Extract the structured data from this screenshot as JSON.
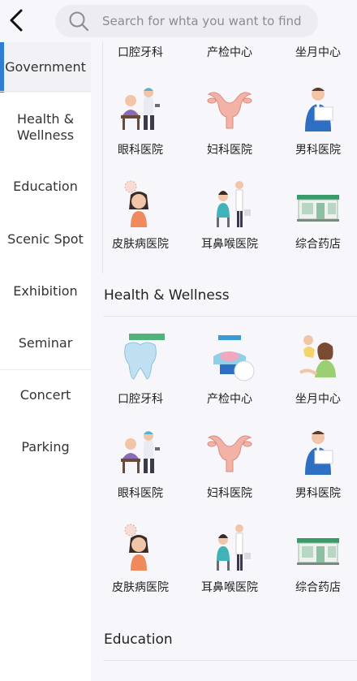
{
  "search": {
    "placeholder": "Search for whta you want to find"
  },
  "sidebar": {
    "items": [
      {
        "label": "Government",
        "active": true
      },
      {
        "label": "Health & Wellness",
        "active": false
      },
      {
        "label": "Education",
        "active": false
      },
      {
        "label": "Scenic Spot",
        "active": false
      },
      {
        "label": "Exhibition",
        "active": false
      },
      {
        "label": "Seminar",
        "active": false
      },
      {
        "label": "Concert",
        "active": false
      },
      {
        "label": "Parking",
        "active": false
      }
    ],
    "accent_color": "#2e7dd7"
  },
  "top_partial_labels": [
    "口腔牙科",
    "产检中心",
    "坐月中心"
  ],
  "government": {
    "items": [
      {
        "label": "眼科医院",
        "icon": "ophthalmology-icon"
      },
      {
        "label": "妇科医院",
        "icon": "uterus-icon"
      },
      {
        "label": "男科医院",
        "icon": "male-doctor-icon"
      },
      {
        "label": "皮肤病医院",
        "icon": "dermatology-icon"
      },
      {
        "label": "耳鼻喉医院",
        "icon": "ent-icon"
      },
      {
        "label": "综合药店",
        "icon": "pharmacy-icon"
      }
    ]
  },
  "health": {
    "title": "Health & Wellness",
    "items": [
      {
        "label": "口腔牙科",
        "icon": "tooth-icon"
      },
      {
        "label": "产检中心",
        "icon": "prenatal-check-icon"
      },
      {
        "label": "坐月中心",
        "icon": "postpartum-care-icon"
      },
      {
        "label": "眼科医院",
        "icon": "ophthalmology-icon"
      },
      {
        "label": "妇科医院",
        "icon": "uterus-icon"
      },
      {
        "label": "男科医院",
        "icon": "male-doctor-icon"
      },
      {
        "label": "皮肤病医院",
        "icon": "dermatology-icon"
      },
      {
        "label": "耳鼻喉医院",
        "icon": "ent-icon"
      },
      {
        "label": "综合药店",
        "icon": "pharmacy-icon"
      }
    ]
  },
  "education": {
    "title": "Education"
  }
}
